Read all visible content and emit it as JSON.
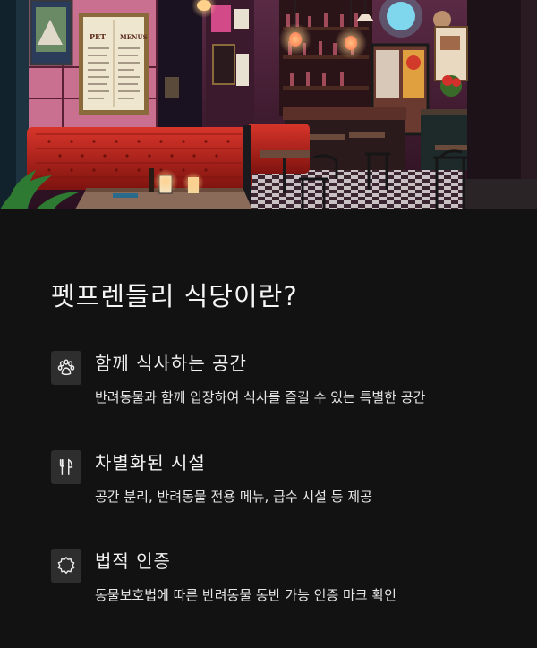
{
  "hero": {
    "image": "restaurant-interior-photo",
    "menu_board_left": "PET",
    "menu_board_right": "MENUS"
  },
  "page_title": "펫프렌들리  식당이란?",
  "features": [
    {
      "icon": "paw-icon",
      "title": "함께  식사하는  공간",
      "description": "반려동물과 함께 입장하여 식사를 즐길 수 있는 특별한 공간"
    },
    {
      "icon": "fork-knife-icon",
      "title": "차별화된  시설",
      "description": "공간 분리, 반려동물 전용 메뉴, 급수 시설 등 제공"
    },
    {
      "icon": "badge-seal-icon",
      "title": "법적  인증",
      "description": "동물보호법에 따른 반려동물 동반 가능 인증 마크 확인"
    }
  ],
  "colors": {
    "background": "#121212",
    "icon_box": "#2e2e2e",
    "text": "#f2f2f2",
    "booth_red": "#c0261c",
    "wall_pink": "#d47b9c"
  }
}
